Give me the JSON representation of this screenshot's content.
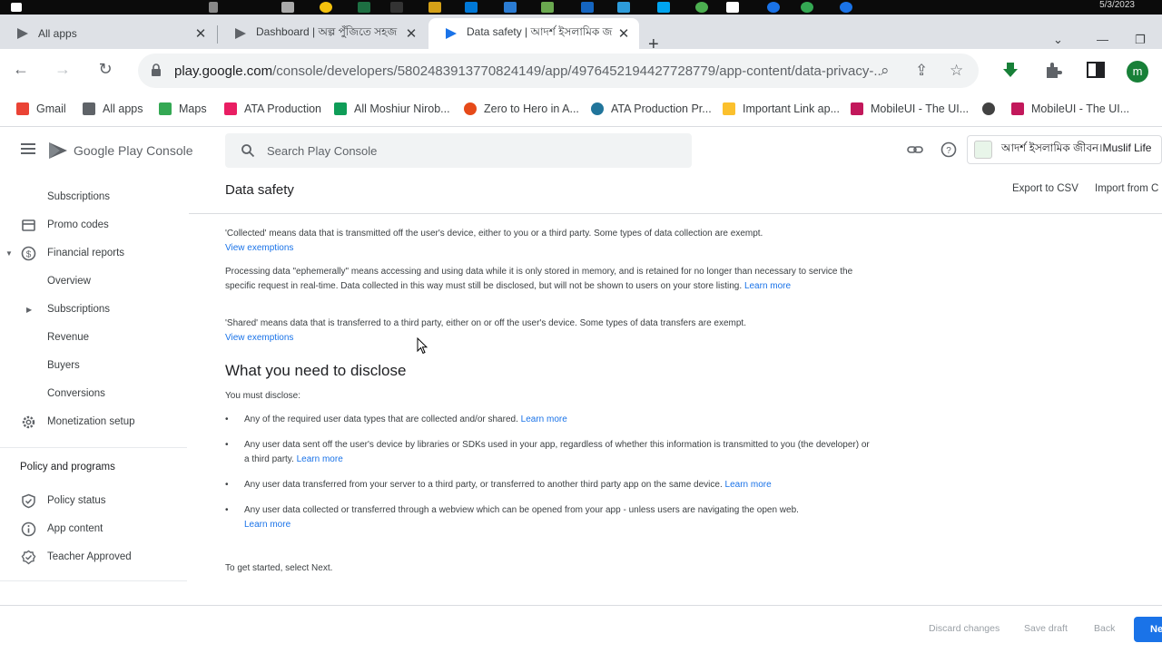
{
  "os": {
    "date": "5/3/2023"
  },
  "tabs": [
    {
      "title": "All apps",
      "active": false
    },
    {
      "title": "Dashboard | অল্প পুঁজিতে সহজ",
      "active": false
    },
    {
      "title": "Data safety | আদর্শ ইসলামিক জ",
      "active": true
    }
  ],
  "address_bar": {
    "host": "play.google.com",
    "path": "/console/developers/5802483913770824149/app/4976452194427728779/app-content/data-privacy-..."
  },
  "bookmarks": [
    {
      "label": "Gmail",
      "color": "#ea4335"
    },
    {
      "label": "All apps",
      "color": "#5f6368"
    },
    {
      "label": "Maps",
      "color": "#34a853"
    },
    {
      "label": "ATA Production",
      "color": "#e91e63"
    },
    {
      "label": "All Moshiur Nirob...",
      "color": "#0f9d58"
    },
    {
      "label": "Zero to Hero in A...",
      "color": "#e64a19"
    },
    {
      "label": "ATA Production Pr...",
      "color": "#21759b"
    },
    {
      "label": "Important Link ap...",
      "color": "#fbc02d"
    },
    {
      "label": "MobileUI - The UI...",
      "color": "#c2185b"
    },
    {
      "label": "",
      "color": "#424242"
    },
    {
      "label": "MobileUI - The UI...",
      "color": "#c2185b"
    }
  ],
  "console": {
    "brand": "Google Play Console",
    "search_placeholder": "Search Play Console",
    "app_name": "আদর্শ ইসলামিক জীবন।Muslif Life"
  },
  "sidebar": {
    "items": [
      {
        "label": "Subscriptions",
        "level": 2
      },
      {
        "label": "Promo codes",
        "level": 1,
        "icon": "promo-icon"
      },
      {
        "label": "Financial reports",
        "level": 1,
        "icon": "dollar-icon",
        "expanded": true
      },
      {
        "label": "Overview",
        "level": 2
      },
      {
        "label": "Subscriptions",
        "level": 2,
        "has_arrow": true
      },
      {
        "label": "Revenue",
        "level": 2
      },
      {
        "label": "Buyers",
        "level": 2
      },
      {
        "label": "Conversions",
        "level": 2
      },
      {
        "label": "Monetization setup",
        "level": 1,
        "icon": "gear-icon"
      }
    ],
    "section_title": "Policy and programs",
    "policy_items": [
      {
        "label": "Policy status",
        "icon": "shield-icon"
      },
      {
        "label": "App content",
        "icon": "info-icon"
      },
      {
        "label": "Teacher Approved",
        "icon": "badge-icon"
      }
    ]
  },
  "page": {
    "title": "Data safety",
    "export_label": "Export to CSV",
    "import_label": "Import from C",
    "collected_text": "'Collected' means data that is transmitted off the user's device, either to you or a third party. Some types of data collection are exempt.",
    "collected_link": "View exemptions",
    "ephemeral_text": "Processing data \"ephemerally\" means accessing and using data while it is only stored in memory, and is retained for no longer than necessary to service the specific request in real-time. Data collected in this way must still be disclosed, but will not be shown to users on your store listing.",
    "ephemeral_link": "Learn more",
    "shared_text": "'Shared' means data that is transferred to a third party, either on or off the user's device. Some types of data transfers are exempt.",
    "shared_link": "View exemptions",
    "disclose_heading": "What you need to disclose",
    "must_disclose": "You must disclose:",
    "bullets": [
      {
        "text": "Any of the required user data types that are collected and/or shared.",
        "link": "Learn more"
      },
      {
        "text": "Any user data sent off the user's device by libraries or SDKs used in your app, regardless of whether this information is transmitted to you (the developer) or a third party.",
        "link": "Learn more"
      },
      {
        "text": "Any user data transferred from your server to a third party, or transferred to another third party app on the same device.",
        "link": "Learn more"
      },
      {
        "text": "Any user data collected or transferred through a webview which can be opened from your app - unless users are navigating the open web.",
        "link": "Learn more"
      }
    ],
    "get_started": "To get started, select Next."
  },
  "footer": {
    "discard_label": "Discard changes",
    "save_label": "Save draft",
    "back_label": "Back",
    "next_label": "Ne"
  }
}
